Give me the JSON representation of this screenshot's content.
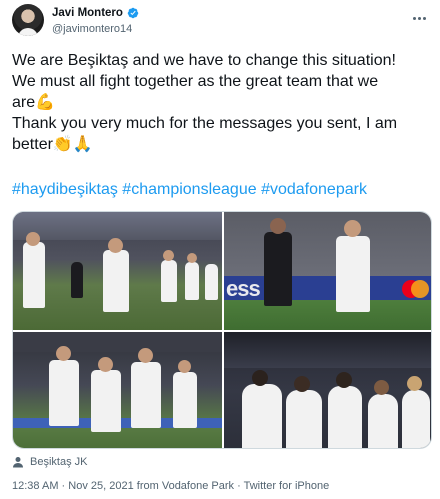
{
  "author": {
    "name": "Javi Montero",
    "handle": "@javimontero14",
    "verified": true
  },
  "tweet": {
    "lines": [
      "We are Beşiktaş and we have to change this situation!",
      "We must all fight together as the great team that we",
      "are💪",
      "Thank you very much for the messages you sent, I am",
      "better👏🙏"
    ],
    "hashtags": [
      "#haydibeşiktaş",
      "#championsleague",
      "#vodafonepark"
    ]
  },
  "media": {
    "photos": [
      {
        "description_icon": "photo-players-walking-out"
      },
      {
        "description_icon": "photo-match-action-mastercard"
      },
      {
        "description_icon": "photo-team-group"
      },
      {
        "description_icon": "photo-goal-celebration"
      }
    ],
    "board_text": "ess"
  },
  "tagged": {
    "label": "Beşiktaş JK"
  },
  "meta": {
    "time": "12:38 AM",
    "date": "Nov 25, 2021",
    "location_prefix": "from",
    "location": "Vodafone Park",
    "separator": "·",
    "client": "Twitter for iPhone"
  },
  "colors": {
    "link": "#1d9bf0",
    "secondary_text": "#536471",
    "primary_text": "#0f1419",
    "verified": "#1d9bf0"
  }
}
